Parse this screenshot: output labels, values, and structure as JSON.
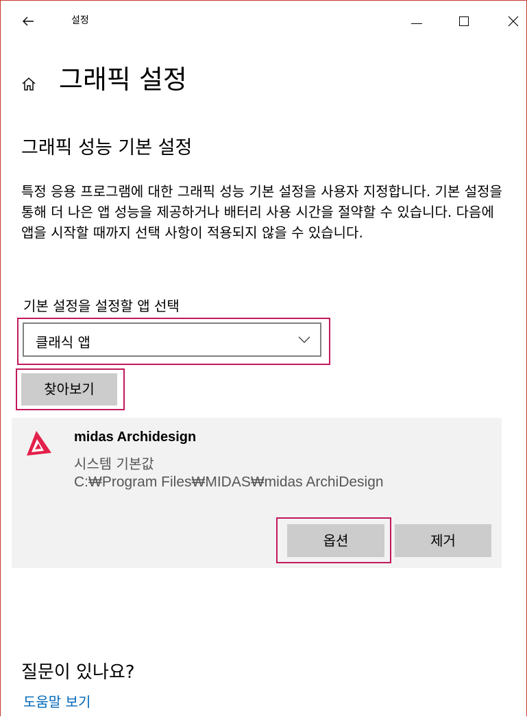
{
  "window": {
    "title": "설정",
    "back_icon": "arrow-left-icon",
    "controls": [
      "minimize-icon",
      "maximize-icon",
      "close-icon"
    ]
  },
  "page": {
    "title": "그래픽 설정",
    "icon": "home-icon"
  },
  "section": {
    "title": "그래픽 성능 기본 설정",
    "description": "특정 응용 프로그램에 대한 그래픽 성능 기본 설정을 사용자 지정합니다. 기본 설정을 통해 더 나은 앱 성능을 제공하거나 배터리 사용 시간을 절약할 수 있습니다. 다음에 앱을 시작할 때까지 선택 사항이 적용되지 않을 수 있습니다."
  },
  "app_select": {
    "label": "기본 설정을 설정할 앱 선택",
    "value": "클래식 앱"
  },
  "browse_button": "찾아보기",
  "app_entry": {
    "name": "midas Archidesign",
    "preference": "시스템 기본값",
    "path": "C:₩Program Files₩MIDAS₩midas ArchiDesign",
    "options_label": "옵션",
    "remove_label": "제거"
  },
  "help": {
    "question": "질문이 있나요?",
    "link": "도움말 보기"
  },
  "colors": {
    "highlight": "#c2185b",
    "link": "#0067b8",
    "button_bg": "#cccccc",
    "panel_bg": "#f2f2f2",
    "logo": "#e3204b"
  }
}
